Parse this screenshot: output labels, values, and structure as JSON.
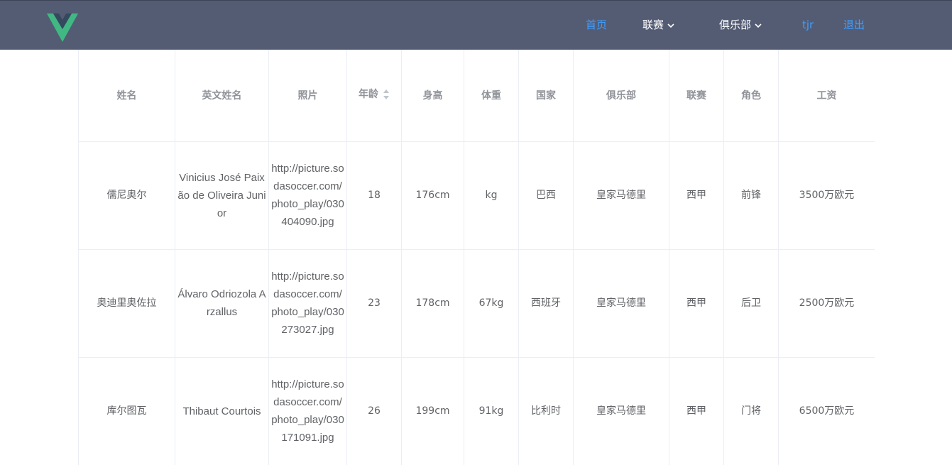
{
  "nav": {
    "home": "首页",
    "league": "联赛",
    "club": "俱乐部",
    "user": "tjr",
    "logout": "退出"
  },
  "colors": {
    "navbar_bg": "#545c74",
    "link": "#409eff",
    "logo_green": "#41b883",
    "logo_dark": "#35495e"
  },
  "table": {
    "headers": [
      "姓名",
      "英文姓名",
      "照片",
      "年龄",
      "身高",
      "体重",
      "国家",
      "俱乐部",
      "联赛",
      "角色",
      "工资"
    ],
    "rows": [
      [
        "儒尼奥尔",
        "Vinicius José Paixão de Oliveira Junior",
        "http://picture.sodasoccer.com/photo_play/030404090.jpg",
        "18",
        "176cm",
        "kg",
        "巴西",
        "皇家马德里",
        "西甲",
        "前锋",
        "3500万欧元"
      ],
      [
        "奥迪里奥佐拉",
        "Álvaro Odriozola Arzallus",
        "http://picture.sodasoccer.com/photo_play/030273027.jpg",
        "23",
        "178cm",
        "67kg",
        "西班牙",
        "皇家马德里",
        "西甲",
        "后卫",
        "2500万欧元"
      ],
      [
        "库尔图瓦",
        "Thibaut Courtois",
        "http://picture.sodasoccer.com/photo_play/030171091.jpg",
        "26",
        "199cm",
        "91kg",
        "比利时",
        "皇家马德里",
        "西甲",
        "门将",
        "6500万欧元"
      ]
    ]
  }
}
